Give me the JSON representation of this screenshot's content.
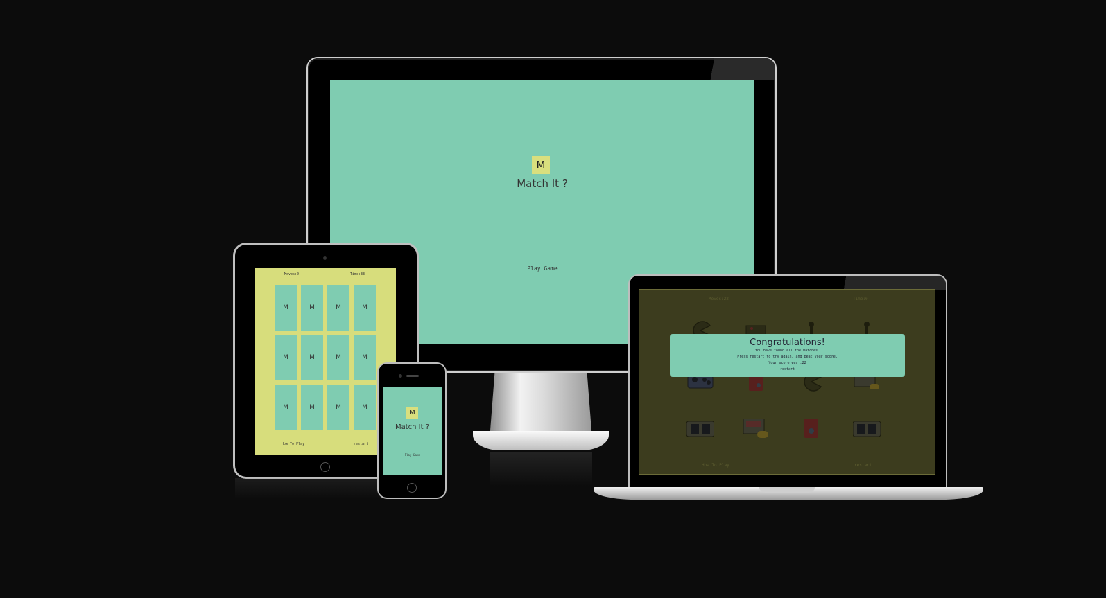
{
  "monitor": {
    "logo_letter": "M",
    "title": "Match It ?",
    "play_label": "Play Game"
  },
  "tablet": {
    "moves_label": "Moves:0",
    "time_label": "Time:33",
    "card_letter": "M",
    "card_count": 12,
    "how_to_label": "How To Play",
    "restart_label": "restart"
  },
  "phone": {
    "logo_letter": "M",
    "title": "Match It ?",
    "play_label": "Play Game"
  },
  "laptop": {
    "moves_label": "Moves:22",
    "time_label": "Time:0",
    "how_to_label": "How To Play",
    "restart_label": "restart",
    "modal": {
      "title": "Congratulations!",
      "line1": "You have found all the matches.",
      "line2": "Press restart to try again, and beat your score.",
      "line3": "Your score was :22",
      "restart_label": "restart"
    },
    "icons": [
      "pacman-icon",
      "arcade-machine-icon",
      "joystick-icon",
      "joystick-icon",
      "arcade-stick-icon",
      "gameboy-icon",
      "pacman-icon",
      "retro-console-icon",
      "handheld-console-icon",
      "retro-console-icon",
      "gameboy-icon",
      "handheld-console-icon"
    ]
  },
  "colors": {
    "background": "#0c0c0c",
    "mint": "#7fccb1",
    "yellow": "#d7dd7c",
    "dim_overlay": "#3c3c1e"
  }
}
